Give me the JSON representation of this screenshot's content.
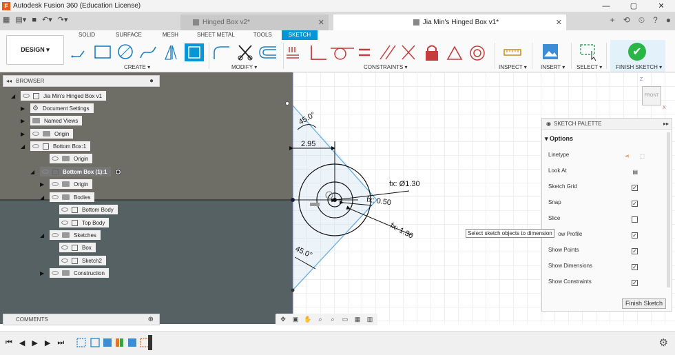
{
  "window": {
    "title": "Autodesk Fusion 360 (Education License)",
    "app_icon": "F",
    "controls": [
      "—",
      "▢",
      "✕"
    ]
  },
  "tabs": [
    {
      "label": "Hinged Box v2*",
      "active": false
    },
    {
      "label": "Jia Min's Hinged Box v1*",
      "active": true
    }
  ],
  "tabs_right_icons": [
    "+",
    "⟲",
    "⏲",
    "?",
    "●"
  ],
  "toolbar": {
    "workspace": "DESIGN ▾",
    "workspace_tabs": [
      "SOLID",
      "SURFACE",
      "MESH",
      "SHEET METAL",
      "TOOLS",
      "SKETCH"
    ],
    "active_tab": "SKETCH",
    "groups": {
      "create": "CREATE ▾",
      "modify": "MODIFY ▾",
      "constraints": "CONSTRAINTS ▾",
      "inspect": "INSPECT ▾",
      "insert": "INSERT ▾",
      "select": "SELECT ▾",
      "finish": "FINISH SKETCH ▾"
    },
    "accent": "#0696d7"
  },
  "browser": {
    "title": "BROWSER",
    "nodes": [
      {
        "label": "Jia Min's Hinged Box v1",
        "kind": "comp"
      },
      {
        "label": "Document Settings",
        "kind": "gear"
      },
      {
        "label": "Named Views",
        "kind": "folder"
      },
      {
        "label": "Origin",
        "kind": "folder"
      },
      {
        "label": "Bottom Box:1",
        "kind": "comp"
      },
      {
        "label": "Origin",
        "kind": "folder"
      },
      {
        "label": "Bottom Box (1):1",
        "kind": "comp"
      },
      {
        "label": "Origin",
        "kind": "folder"
      },
      {
        "label": "Bodies",
        "kind": "folder"
      },
      {
        "label": "Bottom Body",
        "kind": "body"
      },
      {
        "label": "Top Body",
        "kind": "body"
      },
      {
        "label": "Sketches",
        "kind": "folder"
      },
      {
        "label": "Box",
        "kind": "sketch"
      },
      {
        "label": "Sketch2",
        "kind": "sketch"
      },
      {
        "label": "Construction",
        "kind": "folder"
      }
    ]
  },
  "comments": {
    "title": "COMMENTS"
  },
  "sketch": {
    "dims": {
      "angle_top": "45.0°",
      "width": "2.95",
      "outer_dia": "fx: Ø1.30",
      "radius_small": "fx: 0.50",
      "radius_large": "fx: 1.30",
      "angle_bottom": "45.0°"
    }
  },
  "tooltip": "Select sketch objects to dimension",
  "viewcube": {
    "face": "FRONT",
    "z": "Z",
    "x": "X"
  },
  "palette": {
    "title": "SKETCH PALETTE",
    "section": "Options",
    "rows": [
      {
        "label": "Linetype",
        "kind": "icons"
      },
      {
        "label": "Look At",
        "kind": "icon"
      },
      {
        "label": "Sketch Grid",
        "checked": true
      },
      {
        "label": "Snap",
        "checked": true
      },
      {
        "label": "Slice",
        "checked": false
      },
      {
        "label": "ow Profile",
        "checked": true
      },
      {
        "label": "Show Points",
        "checked": true
      },
      {
        "label": "Show Dimensions",
        "checked": true
      },
      {
        "label": "Show Constraints",
        "checked": true
      }
    ],
    "finish_button": "Finish Sketch"
  }
}
